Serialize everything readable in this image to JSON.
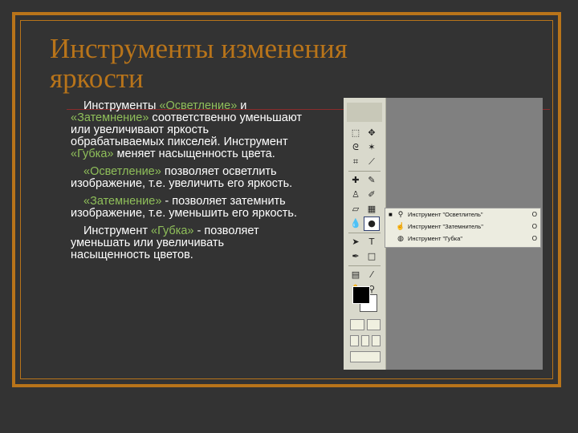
{
  "slide": {
    "title": "Инструменты изменения яркости",
    "paragraphs": [
      {
        "parts": [
          {
            "text": "Инструменты ",
            "hl": false
          },
          {
            "text": "«Осветление»",
            "hl": true
          },
          {
            "text": " и ",
            "hl": false
          },
          {
            "text": "«Затемнение»",
            "hl": true
          },
          {
            "text": " соответственно уменьшают или увеличивают яркость обрабатываемых пикселей. Инструмент ",
            "hl": false
          },
          {
            "text": "«Губка»",
            "hl": true
          },
          {
            "text": " меняет насыщенность цвета.",
            "hl": false
          }
        ]
      },
      {
        "parts": [
          {
            "text": "«Осветление»",
            "hl": true
          },
          {
            "text": " позволяет осветлить изображение, т.е. увеличить его яркость.",
            "hl": false
          }
        ]
      },
      {
        "parts": [
          {
            "text": "«Затемнение»",
            "hl": true
          },
          {
            "text": " - позволяет затемнить изображение, т.е. уменьшить его яркость.",
            "hl": false
          }
        ]
      },
      {
        "parts": [
          {
            "text": "Инструмент ",
            "hl": false
          },
          {
            "text": "«Губка»",
            "hl": true
          },
          {
            "text": " - позволяет уменьшать или увеличивать насыщенность цветов.",
            "hl": false
          }
        ]
      }
    ]
  },
  "toolbox": {
    "flyout_items": [
      {
        "icon": "dodge-icon",
        "label": "Инструмент \"Осветлитель\"",
        "selected": true
      },
      {
        "icon": "burn-icon",
        "label": "Инструмент \"Затемнитель\"",
        "selected": false
      },
      {
        "icon": "sponge-icon",
        "label": "Инструмент \"Губка\"",
        "selected": false
      }
    ]
  },
  "colors": {
    "background": "#333333",
    "frame": "#b8741a",
    "highlight": "#8fbf5a"
  }
}
